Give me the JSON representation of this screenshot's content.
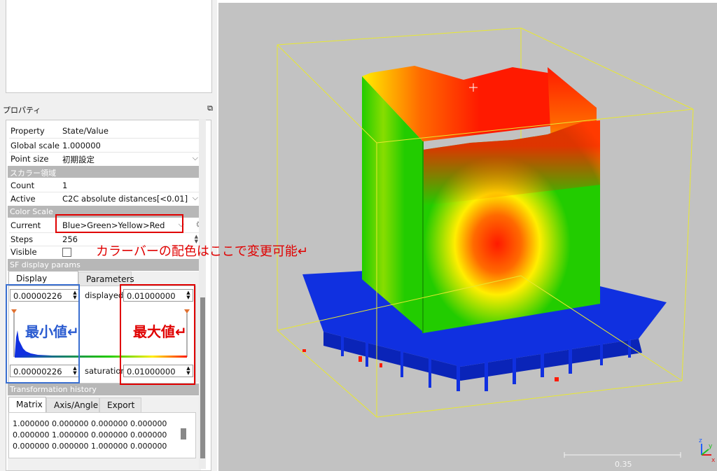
{
  "panel": {
    "title": "プロパティ",
    "float_icon": "⧉"
  },
  "table": {
    "header": {
      "property": "Property",
      "value": "State/Value"
    },
    "global_scale": {
      "k": "Global scale",
      "v": "1.000000"
    },
    "point_size": {
      "k": "Point size",
      "v": "初期設定"
    },
    "section_scalar": "スカラー領域",
    "count": {
      "k": "Count",
      "v": "1"
    },
    "active": {
      "k": "Active",
      "v": "C2C absolute distances[<0.01]"
    },
    "section_color": "Color Scale",
    "current": {
      "k": "Current",
      "v": "Blue>Green>Yellow>Red"
    },
    "steps": {
      "k": "Steps",
      "v": "256"
    },
    "visible": {
      "k": "Visible"
    },
    "section_sf": "SF display params",
    "section_trans": "Transformation history"
  },
  "sf_tabs": [
    "Display ranges",
    "Parameters"
  ],
  "ranges": {
    "displayed_min": "0.00000226",
    "displayed_label": "displayed",
    "displayed_max": "0.01000000",
    "saturation_min": "0.00000226",
    "saturation_label": "saturation",
    "saturation_max": "0.01000000"
  },
  "matrix_tabs": [
    "Matrix",
    "Axis/Angle",
    "Export"
  ],
  "matrix_lines": [
    "1.000000 0.000000 0.000000 0.000000",
    "0.000000 1.000000 0.000000 0.000000",
    "0.000000 0.000000 1.000000 0.000000"
  ],
  "annotations": {
    "color_note": "カラーバーの配色はここで変更可能↵",
    "min_label": "最小値↵",
    "max_label": "最大値↵"
  },
  "viewport": {
    "scale_label": "0.35",
    "colors": {
      "red": "#ff1a00",
      "yellow": "#ffee00",
      "green": "#22cc00",
      "blue": "#1030e0",
      "bbox": "#e8e830"
    }
  },
  "axis": {
    "z": "z",
    "y": "y",
    "x": "x"
  }
}
